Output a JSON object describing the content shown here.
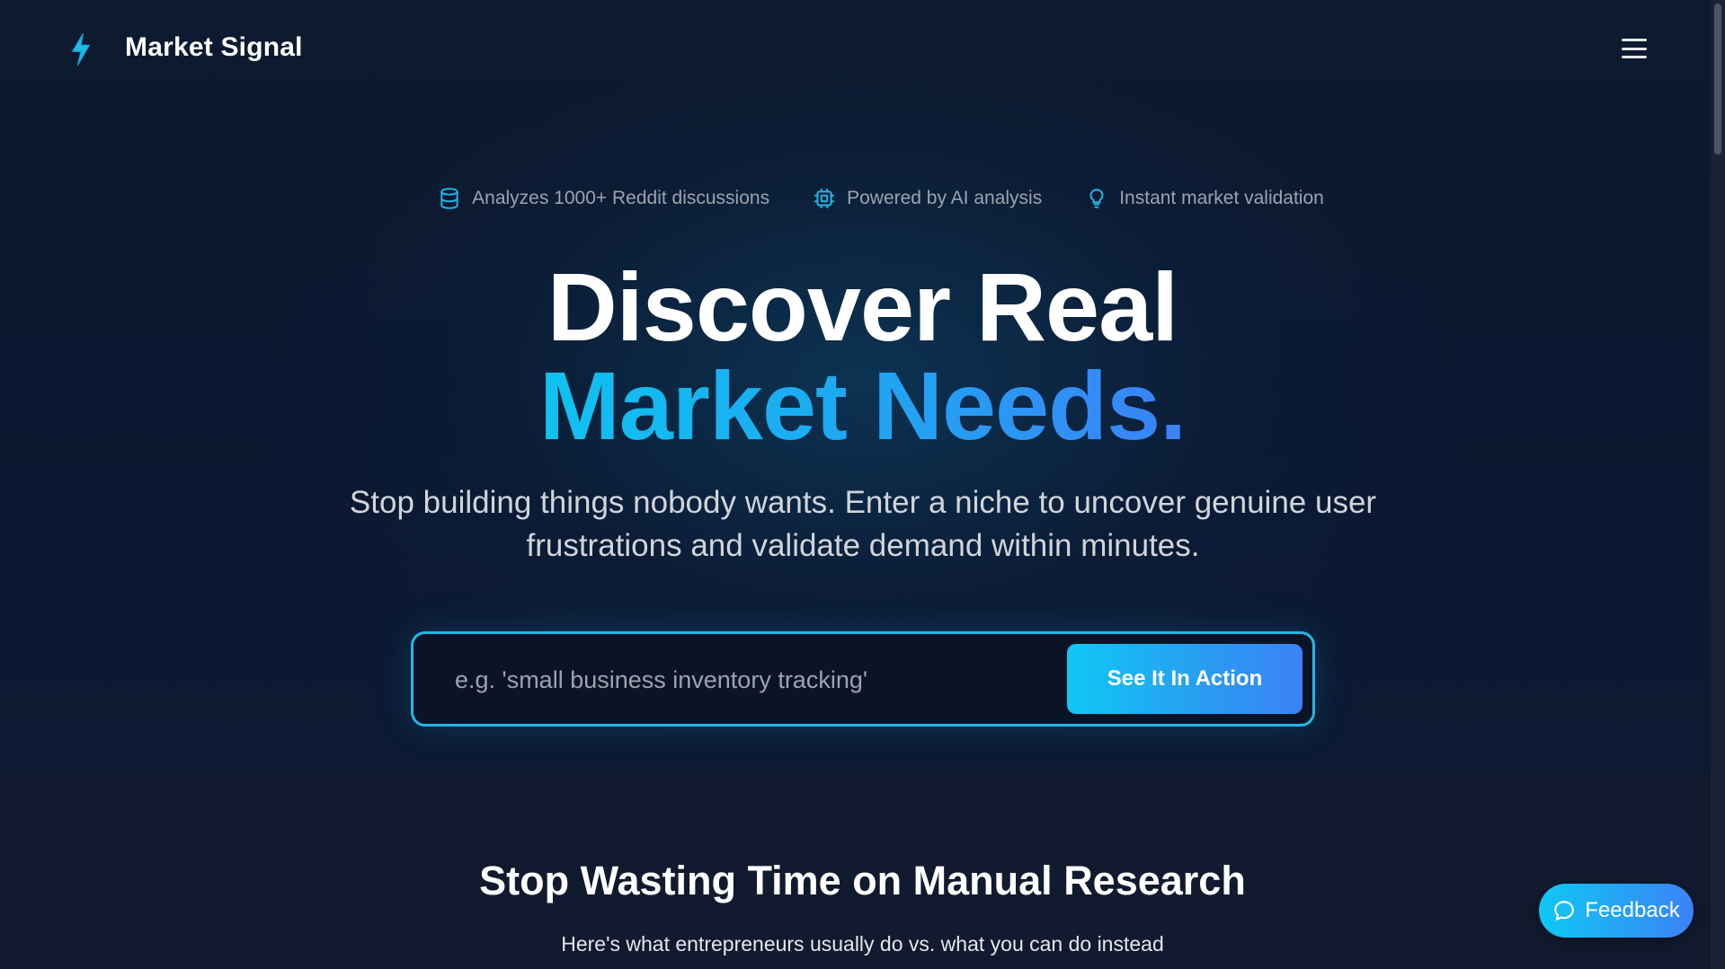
{
  "header": {
    "logo_icon": "lightning-bolt-icon",
    "brand": "Market Signal",
    "menu_icon": "hamburger-menu-icon"
  },
  "features": [
    {
      "icon": "database-icon",
      "label": "Analyzes 1000+ Reddit discussions"
    },
    {
      "icon": "cpu-chip-icon",
      "label": "Powered by AI analysis"
    },
    {
      "icon": "lightbulb-icon",
      "label": "Instant market validation"
    }
  ],
  "hero": {
    "title_line1": "Discover Real",
    "title_line2": "Market Needs.",
    "subtitle": "Stop building things nobody wants. Enter a niche to uncover genuine user frustrations and validate demand within minutes."
  },
  "search": {
    "value": "",
    "placeholder": "e.g. 'small business inventory tracking'",
    "button_label": "See It In Action"
  },
  "section": {
    "title": "Stop Wasting Time on Manual Research",
    "subtitle": "Here's what entrepreneurs usually do vs. what you can do instead"
  },
  "feedback": {
    "icon": "chat-bubble-icon",
    "label": "Feedback"
  },
  "colors": {
    "accent_cyan": "#0fc8f4",
    "accent_blue": "#3b82f6",
    "background": "#0d1a2f"
  }
}
